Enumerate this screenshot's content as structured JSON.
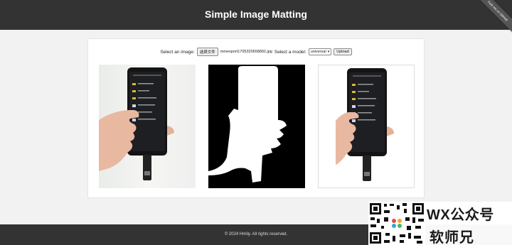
{
  "header": {
    "title": "Simple Image Matting"
  },
  "ribbon": {
    "label": "Fork me on GitHub"
  },
  "form": {
    "select_image_label": "Select an image:",
    "choose_file_button": "选择文件",
    "selected_file": "mmexport1705320658892.jpg",
    "select_model_label": "Select a model:",
    "model_value": "universal",
    "upload_button": "Upload"
  },
  "images": {
    "original": "phone-icon",
    "mask": "alpha-mask",
    "result": "phone-icon"
  },
  "footer": {
    "text": "© 2024 Hmily. All rights reserved."
  },
  "watermark": {
    "line1": "WX公众号",
    "line2": "软师兄"
  },
  "colors": {
    "header_bg": "#333333",
    "footer_bg": "#333333",
    "page_bg": "#f2f2f2"
  }
}
